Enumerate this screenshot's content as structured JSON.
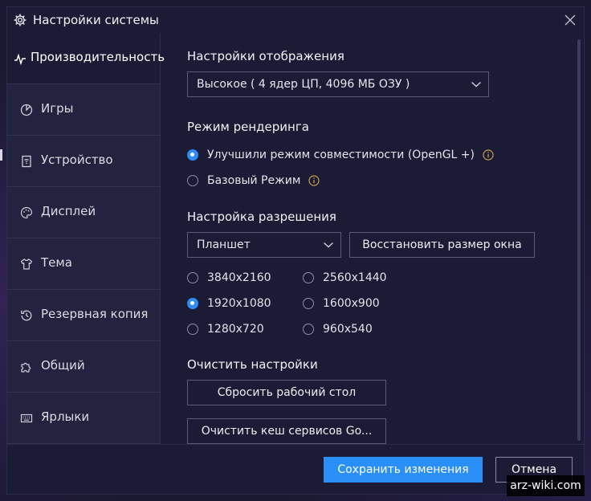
{
  "window": {
    "title": "Настройки системы"
  },
  "sidebar": {
    "items": [
      {
        "label": "Производительность",
        "icon": "pulse-icon",
        "active": true
      },
      {
        "label": "Игры",
        "icon": "game-icon"
      },
      {
        "label": "Устройство",
        "icon": "device-icon"
      },
      {
        "label": "Дисплей",
        "icon": "palette-icon"
      },
      {
        "label": "Тема",
        "icon": "shirt-icon"
      },
      {
        "label": "Резервная копия",
        "icon": "backup-icon"
      },
      {
        "label": "Общий",
        "icon": "puzzle-icon"
      },
      {
        "label": "Ярлыки",
        "icon": "keyboard-icon"
      }
    ]
  },
  "display": {
    "title": "Настройки отображения",
    "selected": "Высокое ( 4 ядер ЦП, 4096 МБ ОЗУ )"
  },
  "render": {
    "title": "Режим рендеринга",
    "option1": "Улучшили режим совместимости (OpenGL +)",
    "option2": "Базовый Режим",
    "selected": "option1"
  },
  "resolution": {
    "title": "Настройка разрешения",
    "mode": "Планшет",
    "restore_label": "Восстановить размер окна",
    "options": [
      "3840x2160",
      "2560x1440",
      "1920x1080",
      "1600x900",
      "1280x720",
      "960x540"
    ],
    "selected": "1920x1080"
  },
  "clear": {
    "title": "Очистить настройки",
    "reset_desktop": "Сбросить рабочий стол",
    "clear_cache": "Очистить кеш сервисов Go..."
  },
  "footer": {
    "save_label": "Сохранить изменения",
    "cancel_label": "Отмена"
  },
  "watermark": "arz-wiki.com",
  "colors": {
    "accent": "#2a8ff7",
    "background": "#1c1b36",
    "sidebar": "#23223f",
    "info": "#c8a24a"
  }
}
